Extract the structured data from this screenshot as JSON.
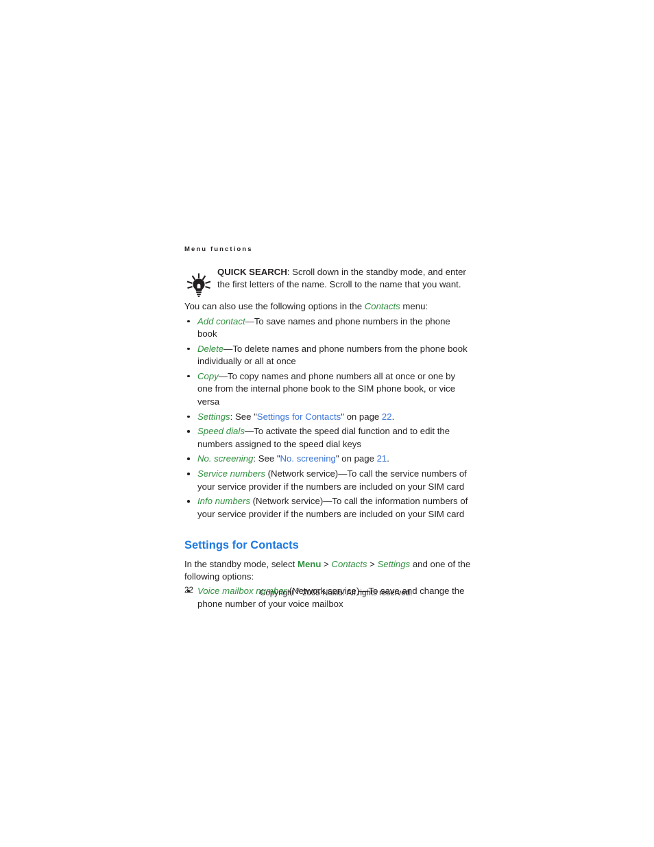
{
  "colors": {
    "term_green": "#2f8f3e",
    "xref_blue": "#3a74d6",
    "heading_blue": "#1f7ae0",
    "body_text": "#231f20",
    "page_background": "#ffffff"
  },
  "running_header": {
    "text": "Menu functions"
  },
  "tip": {
    "icon_name": "lightbulb-tip-icon",
    "lead": "QUICK SEARCH",
    "body": ": Scroll down in the standby mode, and enter the first letters of the name. Scroll to the name that you want."
  },
  "intro": {
    "before_term": "You can also use the following options in the ",
    "term": "Contacts",
    "after_term": " menu:"
  },
  "options_list": [
    {
      "term": "Add contact",
      "rest": "—To save names and phone numbers in the phone book"
    },
    {
      "term": "Delete",
      "rest": "—To delete names and phone numbers from the phone book individually or all at once"
    },
    {
      "term": "Copy",
      "rest": "—To copy names and phone numbers all at once or one by one from the internal phone book to the SIM phone book, or vice versa"
    },
    {
      "term": "Settings",
      "rest": ": See \"",
      "xref": "Settings for Contacts",
      "rest2": "\" on page ",
      "page_ref": "22",
      "rest3": "."
    },
    {
      "term": "Speed dials",
      "rest": "—To activate the speed dial function and to edit the numbers assigned to the speed dial keys"
    },
    {
      "term": "No. screening",
      "rest": ": See \"",
      "xref": "No. screening",
      "rest2": "\" on page ",
      "page_ref": "21",
      "rest3": "."
    },
    {
      "term": "Service numbers",
      "rest": " (Network service)—To call the service numbers of your service provider if the numbers are included on your SIM card"
    },
    {
      "term": "Info numbers",
      "rest": " (Network service)—To call the information numbers of your service provider if the numbers are included on your SIM card"
    }
  ],
  "section": {
    "heading": "Settings for Contacts",
    "intro_part1": "In the standby mode, select ",
    "intro_menu": "Menu",
    "intro_sep1": " > ",
    "intro_contacts": "Contacts",
    "intro_sep2": " > ",
    "intro_settings": "Settings",
    "intro_part2": " and one of the following options:",
    "items": [
      {
        "term": "Voice mailbox number",
        "rest": " (Network service)—To save and change the phone number of your voice mailbox"
      }
    ]
  },
  "footer": {
    "page_number": "22",
    "copyright_before": "Copyright ",
    "copyright_symbol": "®",
    "copyright_after": " 2005 Nokia. All rights reserved."
  }
}
